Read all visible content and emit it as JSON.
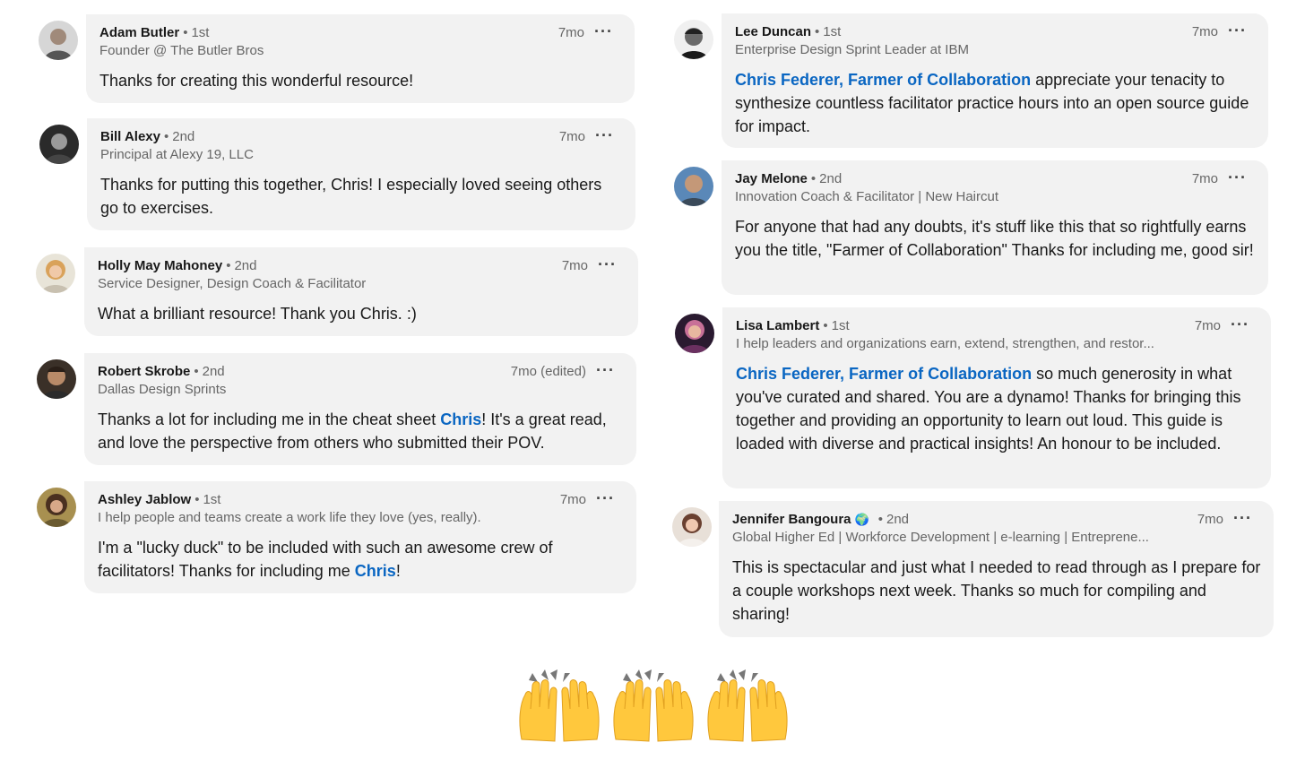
{
  "comments": [
    {
      "name": "Adam Butler",
      "degree": "1st",
      "headline": "Founder @ The Butler Bros",
      "time": "7mo",
      "parts": [
        {
          "t": "Thanks for creating this wonderful resource!"
        }
      ]
    },
    {
      "name": "Bill Alexy",
      "degree": "2nd",
      "headline": "Principal at Alexy 19, LLC",
      "time": "7mo",
      "parts": [
        {
          "t": "Thanks for putting this together, Chris! I especially loved seeing others go to exercises."
        }
      ]
    },
    {
      "name": "Holly May Mahoney",
      "degree": "2nd",
      "headline": "Service Designer, Design Coach & Facilitator",
      "time": "7mo",
      "parts": [
        {
          "t": "What a brilliant resource! Thank you Chris. :)"
        }
      ]
    },
    {
      "name": "Robert Skrobe",
      "degree": "2nd",
      "headline": "Dallas Design Sprints",
      "time": "7mo (edited)",
      "parts": [
        {
          "t": "Thanks a lot for including me in the cheat sheet "
        },
        {
          "t": "Chris",
          "mention": true
        },
        {
          "t": "!  It's a great read, and love the perspective from others who submitted their POV."
        }
      ]
    },
    {
      "name": "Ashley Jablow",
      "degree": "1st",
      "headline": "I help people and teams create a work life they love (yes, really).",
      "time": "7mo",
      "parts": [
        {
          "t": "I'm a \"lucky duck\" to be included with such an awesome crew of facilitators! Thanks for including me "
        },
        {
          "t": "Chris",
          "mention": true
        },
        {
          "t": "!"
        }
      ]
    },
    {
      "name": "Lee Duncan",
      "degree": "1st",
      "headline": "Enterprise Design Sprint Leader at IBM",
      "time": "7mo",
      "parts": [
        {
          "t": "Chris Federer, Farmer of Collaboration",
          "mention": true
        },
        {
          "t": " appreciate your tenacity to synthesize countless facilitator practice hours into an open source guide for impact."
        }
      ]
    },
    {
      "name": "Jay Melone",
      "degree": "2nd",
      "headline": "Innovation Coach & Facilitator | New Haircut",
      "time": "7mo",
      "parts": [
        {
          "t": "For anyone that had any doubts, it's stuff like this that so rightfully earns you the title, \"Farmer of Collaboration\" Thanks for including me, good sir!"
        }
      ]
    },
    {
      "name": "Lisa Lambert",
      "degree": "1st",
      "headline": "I help leaders and organizations earn, extend, strengthen, and restor...",
      "time": "7mo",
      "parts": [
        {
          "t": "Chris Federer, Farmer of Collaboration",
          "mention": true
        },
        {
          "t": " so much generosity in what you've curated and shared. You are a dynamo! Thanks for bringing this together and providing an opportunity to learn out loud. This guide is loaded with diverse and practical insights! An honour to be included."
        }
      ]
    },
    {
      "name": "Jennifer Bangoura",
      "badge": "🌍",
      "degree": "2nd",
      "headline": "Global Higher Ed | Workforce Development | e-learning | Entreprene...",
      "time": "7mo",
      "parts": [
        {
          "t": "This is spectacular and just what I needed to read through as I prepare for a couple workshops next week. Thanks so much for compiling and sharing!"
        }
      ]
    }
  ],
  "footer": {
    "emoji": "🙌"
  },
  "colors": {
    "bubble": "#f2f2f2",
    "mention": "#0a66c2",
    "meta": "#666666"
  }
}
